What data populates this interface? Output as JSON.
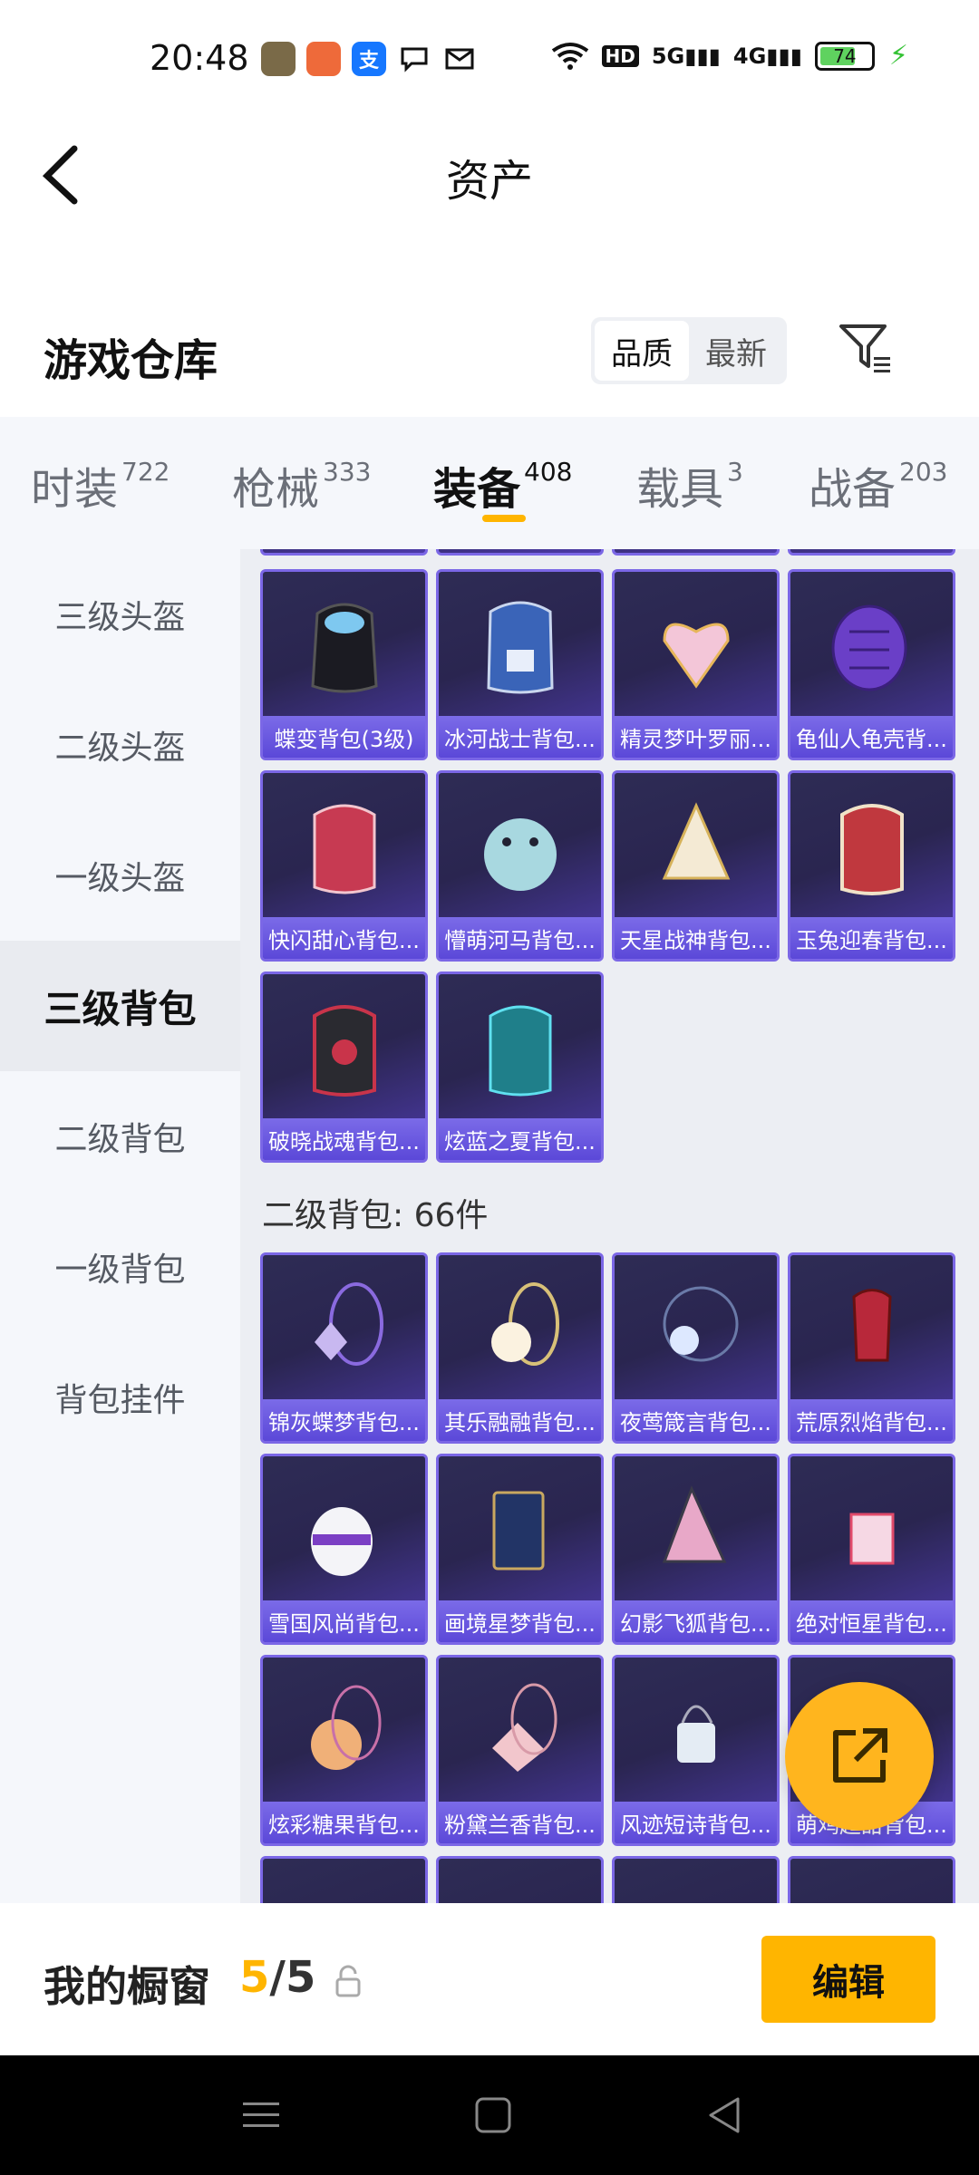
{
  "status_bar": {
    "time": "20:48",
    "apps": [
      {
        "icon": "game-app-icon",
        "glyph": "",
        "color": "#6b5a3a"
      },
      {
        "icon": "mail-app-icon",
        "glyph": "",
        "color": "#ee6a3a"
      },
      {
        "icon": "alipay-icon",
        "glyph": "支",
        "color": "#1677ff"
      },
      {
        "icon": "chat-bubble-icon",
        "glyph": "",
        "color": "#ffffff"
      },
      {
        "icon": "message-icon",
        "glyph": "",
        "color": "#ffffff"
      }
    ],
    "hd_label": "HD",
    "network_5g": "5G",
    "network_4g": "4G",
    "battery_percent": 74,
    "battery_level_text": "74"
  },
  "header": {
    "title": "资产"
  },
  "warehouse": {
    "title": "游戏仓库",
    "sort_options": [
      "品质",
      "最新"
    ],
    "active_sort": 0
  },
  "tabs": [
    {
      "label": "时装",
      "count": "722"
    },
    {
      "label": "枪械",
      "count": "333"
    },
    {
      "label": "装备",
      "count": "408"
    },
    {
      "label": "载具",
      "count": "3"
    },
    {
      "label": "战备",
      "count": "203"
    }
  ],
  "active_tab": 2,
  "sidebar": {
    "items": [
      "三级头盔",
      "二级头盔",
      "一级头盔",
      "三级背包",
      "二级背包",
      "一级背包",
      "背包挂件"
    ],
    "active_index": 3
  },
  "level3_items": [
    "蝶变背包(3级)",
    "冰河战士背包...",
    "精灵梦叶罗丽...",
    "龟仙人龟壳背...",
    "快闪甜心背包...",
    "懵萌河马背包...",
    "天星战神背包...",
    "玉兔迎春背包...",
    "破晓战魂背包...",
    "炫蓝之夏背包..."
  ],
  "level2_section": {
    "header": "二级背包: 66件",
    "items": [
      "锦灰蝶梦背包...",
      "其乐融融背包...",
      "夜莺箴言背包...",
      "荒原烈焰背包...",
      "雪国风尚背包...",
      "画境星梦背包...",
      "幻影飞狐背包...",
      "绝对恒星背包...",
      "炫彩糖果背包...",
      "粉黛兰香背包...",
      "风迹短诗背包...",
      "萌鸡超甜背包..."
    ]
  },
  "showcase": {
    "title": "我的橱窗",
    "current": "5",
    "separator": "/",
    "total": "5",
    "edit_label": "编辑"
  },
  "colors": {
    "accent": "#ffb500",
    "card_border": "#7b67e6",
    "card_label": "#5b48d8"
  }
}
